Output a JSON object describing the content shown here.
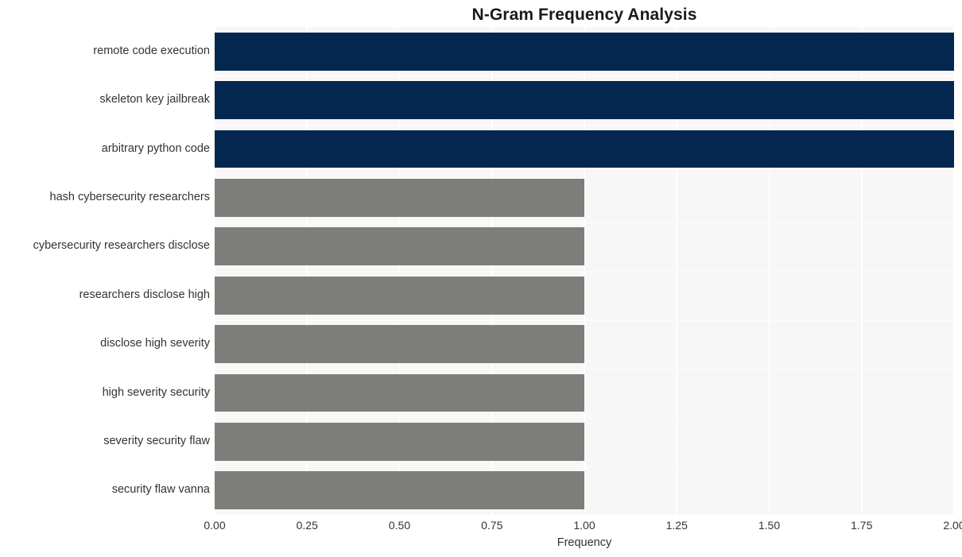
{
  "chart_data": {
    "type": "bar",
    "orientation": "horizontal",
    "title": "N-Gram Frequency Analysis",
    "xlabel": "Frequency",
    "ylabel": "",
    "xlim": [
      0,
      2
    ],
    "xticks": [
      "0.00",
      "0.25",
      "0.50",
      "0.75",
      "1.00",
      "1.25",
      "1.50",
      "1.75",
      "2.00"
    ],
    "xtick_values": [
      0,
      0.25,
      0.5,
      0.75,
      1.0,
      1.25,
      1.5,
      1.75,
      2.0
    ],
    "grid": true,
    "legend": "none",
    "categories": [
      "remote code execution",
      "skeleton key jailbreak",
      "arbitrary python code",
      "hash cybersecurity researchers",
      "cybersecurity researchers disclose",
      "researchers disclose high",
      "disclose high severity",
      "high severity security",
      "severity security flaw",
      "security flaw vanna"
    ],
    "values": [
      2,
      2,
      2,
      1,
      1,
      1,
      1,
      1,
      1,
      1
    ],
    "bar_colors": [
      "#042750",
      "#042750",
      "#042750",
      "#7d7d7a",
      "#7d7d7a",
      "#7d7d7a",
      "#7d7d7a",
      "#7d7d7a",
      "#7d7d7a",
      "#7d7d7a"
    ]
  },
  "style": {
    "plot_background": "#f7f7f7",
    "figure_background": "#ffffff",
    "gridline_color": "#ffffff",
    "text_color": "#333333",
    "title_color": "#1a1a1a",
    "highlight_color": "#042750",
    "muted_color": "#7d7d7a"
  }
}
